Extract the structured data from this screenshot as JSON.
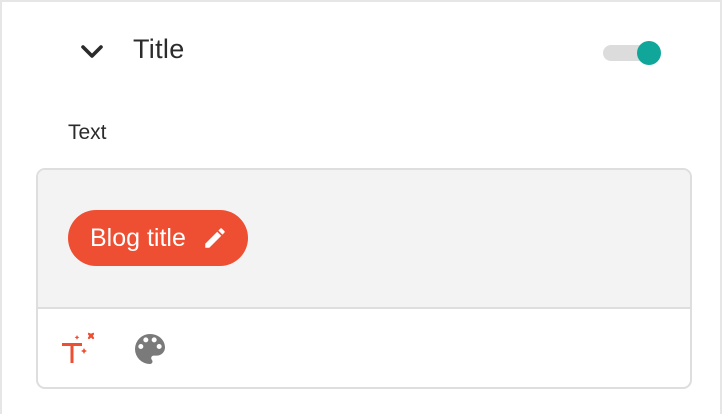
{
  "section": {
    "title": "Title",
    "expanded": true,
    "enabled": true,
    "chevron_icon": "chevron-down-icon"
  },
  "colors": {
    "accent": "#10a69a",
    "chip": "#ee4e32",
    "editor_background": "#f3f3f3"
  },
  "field": {
    "label": "Text",
    "chip_text": "Blog title",
    "chip_icon": "pencil-icon"
  },
  "toolbar": {
    "icons": [
      "ai-text-sparkle-icon",
      "palette-icon"
    ]
  }
}
